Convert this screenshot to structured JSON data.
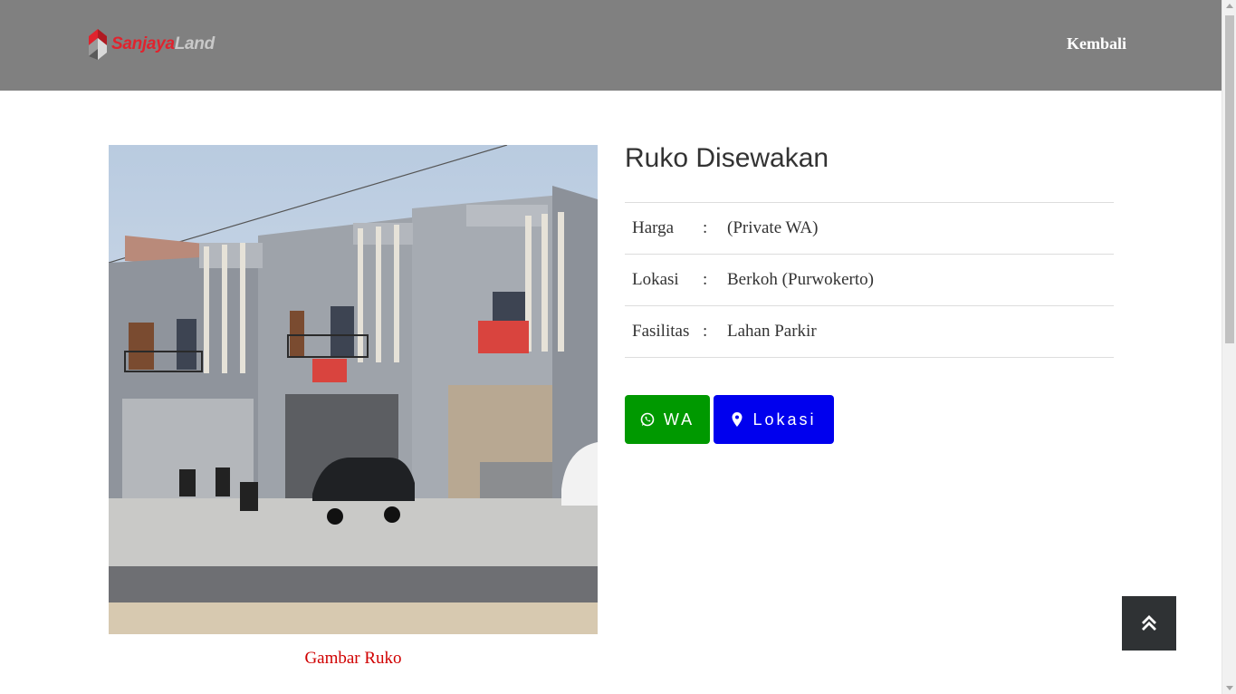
{
  "navbar": {
    "logo_part1": "Sanjaya",
    "logo_part2": "Land",
    "back_link": "Kembali"
  },
  "listing": {
    "title": "Ruko Disewakan",
    "photo_caption": "Gambar Ruko",
    "details": [
      {
        "label": "Harga",
        "separator": ":",
        "value": "(Private WA)"
      },
      {
        "label": "Lokasi",
        "separator": ":",
        "value": "Berkoh (Purwokerto)"
      },
      {
        "label": "Fasilitas",
        "separator": ":",
        "value": "Lahan Parkir"
      }
    ]
  },
  "actions": {
    "wa_label": "WA",
    "location_label": "Lokasi",
    "wa_icon": "whatsapp-icon",
    "location_icon": "map-marker-icon",
    "to_top_icon": "double-chevron-up-icon"
  },
  "colors": {
    "navbar_bg": "#808080",
    "wa_button": "#009900",
    "location_button": "#0000ee",
    "caption": "#d00000",
    "to_top_bg": "#2f3234"
  }
}
